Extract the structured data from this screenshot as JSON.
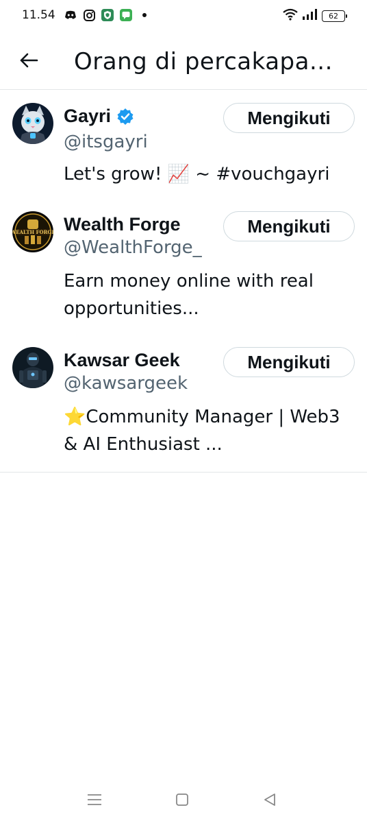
{
  "status_bar": {
    "time": "11.54",
    "battery": "62",
    "icons": [
      "discord-icon",
      "instagram-icon",
      "vpn-shield-icon",
      "messages-icon",
      "notification-dot-icon",
      "wifi-icon",
      "signal-icon",
      "battery-icon"
    ]
  },
  "header": {
    "back_icon": "arrow-left-icon",
    "title": "Orang di percakapa..."
  },
  "users": [
    {
      "name": "Gayri",
      "verified": true,
      "handle": "@itsgayri",
      "bio": "Let's grow! 📈 ~ #vouchgayri",
      "follow_label": "Mengikuti"
    },
    {
      "name": "Wealth Forge",
      "verified": false,
      "handle": "@WealthForge_",
      "bio": "Earn money online with real opportunities...",
      "follow_label": "Mengikuti",
      "avatar_text": "WEALTH FORGE"
    },
    {
      "name": "Kawsar Geek",
      "verified": false,
      "handle": "@kawsargeek",
      "bio": "⭐Community Manager | Web3 & AI Enthusiast ...",
      "follow_label": "Mengikuti"
    }
  ],
  "colors": {
    "text_primary": "#0f1419",
    "text_secondary": "#536471",
    "verified_blue": "#1d9bf0",
    "divider": "#e3e6e8",
    "button_border": "#cfd9de"
  },
  "nav_bar": {
    "icons": [
      "recent-apps-icon",
      "home-icon",
      "back-triangle-icon"
    ]
  }
}
